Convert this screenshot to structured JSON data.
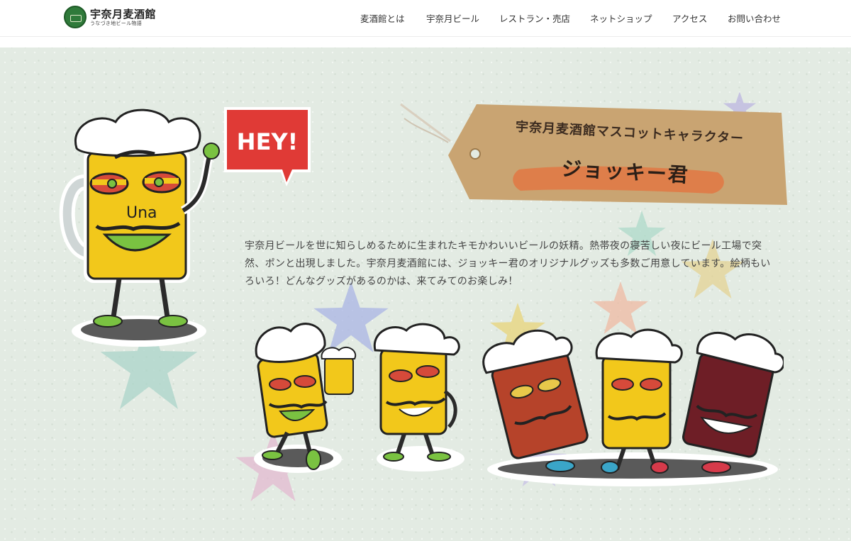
{
  "header": {
    "logo_title": "宇奈月麦酒館",
    "logo_sub": "うなづき地ビール物語",
    "nav": [
      {
        "label": "麦酒館とは"
      },
      {
        "label": "宇奈月ビール"
      },
      {
        "label": "レストラン・売店"
      },
      {
        "label": "ネットショップ"
      },
      {
        "label": "アクセス"
      },
      {
        "label": "お問い合わせ"
      }
    ]
  },
  "hero": {
    "bubble_text": "HEY!",
    "tag_title": "宇奈月麦酒館マスコットキャラクター",
    "tag_name": "ジョッキー君",
    "mug_letters": "Una",
    "description_lines": [
      "宇奈月ビールを世に知らしめるために生まれたキモかわいいビールの妖精。熱帯夜の寝苦しい夜にビール工場で突",
      "然、ポンと出現しました。宇奈月麦酒館には、ジョッキー君のオリジナルグッズも多数ご用意しています。絵柄もい",
      "ろいろ！どんなグッズがあるのかは、来てみてのお楽しみ！"
    ]
  },
  "colors": {
    "background": "#e3ebe3",
    "beer": "#f2c81b",
    "amber_beer": "#b6432a",
    "dark_beer": "#6e1e26",
    "speech_bubble": "#e03a36",
    "tag_paper": "#c9a472",
    "brush_stroke": "#e07a46",
    "logo_green": "#2f7a3a"
  }
}
